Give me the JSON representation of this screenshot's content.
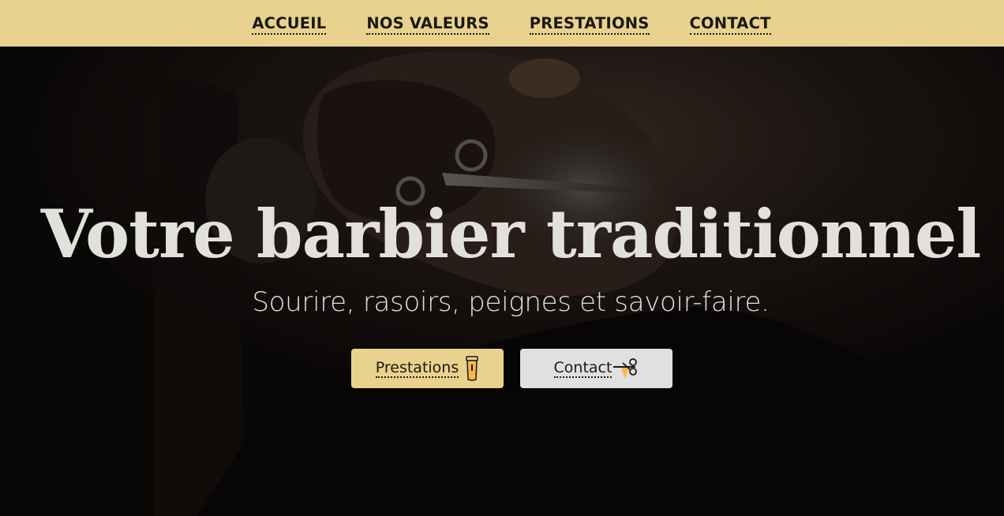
{
  "nav": {
    "links": [
      {
        "label": "ACCUEIL"
      },
      {
        "label": "NOS VALEURS"
      },
      {
        "label": "PRESTATIONS"
      },
      {
        "label": "CONTACT"
      }
    ]
  },
  "hero": {
    "title": "Votre barbier traditionnel",
    "subtitle": "Sourire, rasoirs, peignes et savoir-faire.",
    "buttons": {
      "primary": {
        "label": "Prestations",
        "icon": "trimmer-icon"
      },
      "secondary": {
        "label": "Contact",
        "icon": "scissors-pin-icon"
      }
    }
  },
  "colors": {
    "nav_background": "#e8d28d",
    "accent": "#e8d28d",
    "hero_overlay": "#0b0908",
    "hero_text": "#e2e0dc",
    "secondary_button": "#e0e0e0"
  }
}
